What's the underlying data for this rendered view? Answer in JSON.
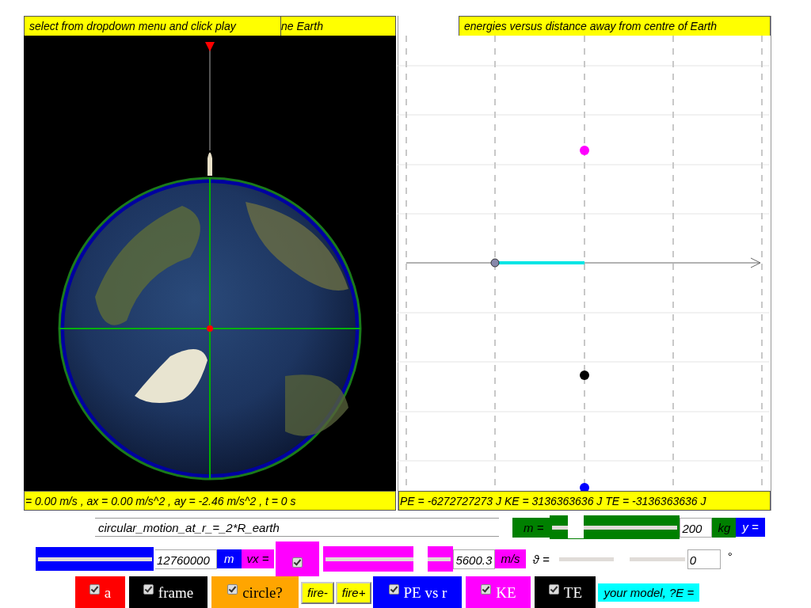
{
  "simulation_view": {
    "instruction": "select from dropdown menu and click play",
    "title_fragment": "ne Earth",
    "readout": "= 0.00 m/s , ax = 0.00 m/s^2 , ay = -2.46 m/s^2 , t = 0 s"
  },
  "energy_graph": {
    "title": "energies versus distance away from centre of Earth",
    "readout": "PE = -6272727273 J KE = 3136363636 J TE = -3136363636 J"
  },
  "preset_field": {
    "value": "circular_motion_at_r_=_2*R_earth"
  },
  "mass": {
    "label": "m =",
    "level": 0.2,
    "value": "200",
    "unit": "kg"
  },
  "y_label": "y =",
  "radius": {
    "level": 1,
    "value": "12760000",
    "unit": "m"
  },
  "vx": {
    "label": "vx =",
    "checked": true,
    "level": 0.75,
    "value": "5600.3",
    "unit": "m/s"
  },
  "angle": {
    "label": "ϑ =",
    "level": 0.5,
    "value": "0",
    "unit": "°"
  },
  "bottom_bar": [
    {
      "kind": "toggle",
      "label": "a",
      "checked": true,
      "color": "#ff0000"
    },
    {
      "kind": "toggle",
      "label": "frame",
      "checked": true,
      "color": "#000000"
    },
    {
      "kind": "toggle",
      "label": "circle?",
      "checked": true,
      "color": "#ffa500"
    },
    {
      "kind": "button",
      "label": "fire-"
    },
    {
      "kind": "button",
      "label": "fire+"
    },
    {
      "kind": "toggle",
      "label": "PE vs r",
      "checked": true,
      "color": "#0000ff"
    },
    {
      "kind": "toggle",
      "label": "KE",
      "checked": true,
      "color": "#ff00ff"
    },
    {
      "kind": "toggle",
      "label": "TE",
      "checked": true,
      "color": "#000000"
    },
    {
      "kind": "label",
      "label": "your model, ?E ="
    }
  ]
}
